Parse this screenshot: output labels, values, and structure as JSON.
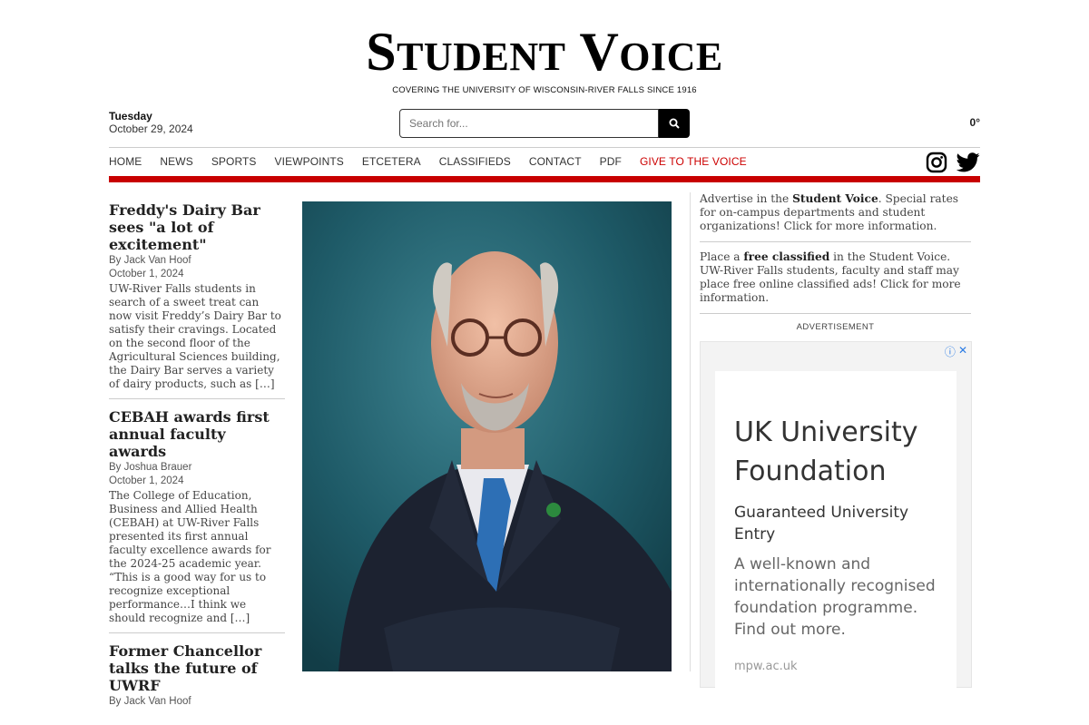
{
  "masthead": {
    "logo_s": "S",
    "logo_tudent": "TUDENT",
    "logo_v": "V",
    "logo_oice": "OICE",
    "tagline": "Covering the University of Wisconsin-River Falls since 1916"
  },
  "date": {
    "day": "Tuesday",
    "date": "October 29, 2024"
  },
  "search": {
    "placeholder": "Search for..."
  },
  "weather": {
    "temp": "0°"
  },
  "nav": {
    "items": [
      "HOME",
      "NEWS",
      "SPORTS",
      "VIEWPOINTS",
      "ETCETERA",
      "CLASSIFIEDS",
      "CONTACT",
      "PDF",
      "GIVE TO THE VOICE"
    ]
  },
  "stories": [
    {
      "title": "Freddy's Dairy Bar sees \"a lot of excitement\"",
      "byline": "By Jack Van Hoof",
      "date": "October 1, 2024",
      "excerpt": "UW-River Falls students in search of a sweet treat can now visit Freddy’s Dairy Bar to satisfy their cravings. Located on the second floor of the Agricultural Sciences building, the Dairy Bar serves a variety of dairy products, such as […]"
    },
    {
      "title": "CEBAH awards first annual faculty awards",
      "byline": "By Joshua Brauer",
      "date": "October 1, 2024",
      "excerpt": "The College of Education, Business and Allied Health (CEBAH) at UW-River Falls presented its first annual faculty excellence awards for the 2024-25 academic year. “This is a good way for us to recognize exceptional performance…I think we should recognize and […]"
    },
    {
      "title": "Former Chancellor talks the future of UWRF",
      "byline": "By Jack Van Hoof",
      "date": "",
      "excerpt": ""
    }
  ],
  "promos": {
    "advertise_pre": "Advertise in the ",
    "advertise_bold": "Student Voice",
    "advertise_post": ". Special rates for on-campus departments and student organizations! Click for more information.",
    "classified_pre": "Place a ",
    "classified_bold": "free classified",
    "classified_post": " in the Student Voice. UW-River Falls students, faculty and staff may place free online classified ads! Click for more information."
  },
  "ad": {
    "label": "ADVERTISEMENT",
    "headline": "UK University Foundation",
    "subhead": "Guaranteed University Entry",
    "description": "A well-known and internationally recognised foundation programme. Find out more.",
    "url": "mpw.ac.uk"
  },
  "icons": {
    "search": "search-icon",
    "instagram": "instagram-icon",
    "twitter": "twitter-icon",
    "adinfo": "info-icon",
    "adclose": "close-icon"
  },
  "colors": {
    "accent": "#c80000",
    "give_link": "#cc0000",
    "ad_icon": "#2a7be4"
  }
}
